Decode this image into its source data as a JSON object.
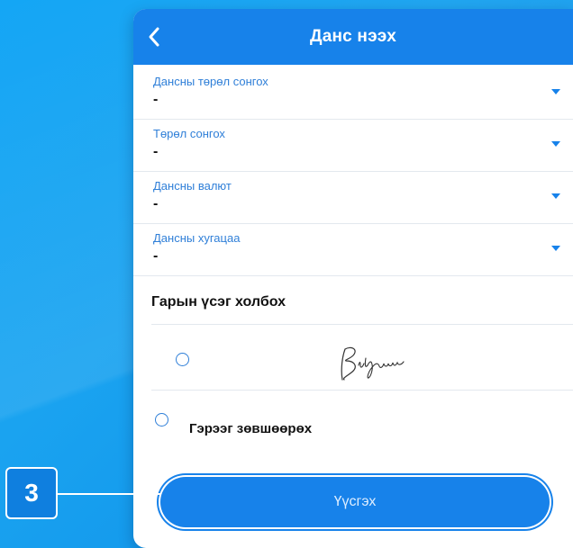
{
  "header": {
    "title": "Данс нээх",
    "back_icon": "chevron-left-icon"
  },
  "fields": [
    {
      "label": "Дансны төрөл сонгох",
      "value": "-"
    },
    {
      "label": "Төрөл сонгох",
      "value": "-"
    },
    {
      "label": "Дансны валют",
      "value": "-"
    },
    {
      "label": "Дансны хугацаа",
      "value": "-"
    }
  ],
  "signature_section": {
    "title": "Гарын үсэг холбох",
    "signature_icon": "handwritten-signature"
  },
  "agreement": {
    "label": "Гэрээг зөвшөөрөх"
  },
  "create_button": {
    "label": "Үүсгэх"
  },
  "step_badge": {
    "number": "3"
  },
  "colors": {
    "primary": "#1782ea",
    "label_blue": "#2f7fd8",
    "background": "#14a6f5"
  }
}
